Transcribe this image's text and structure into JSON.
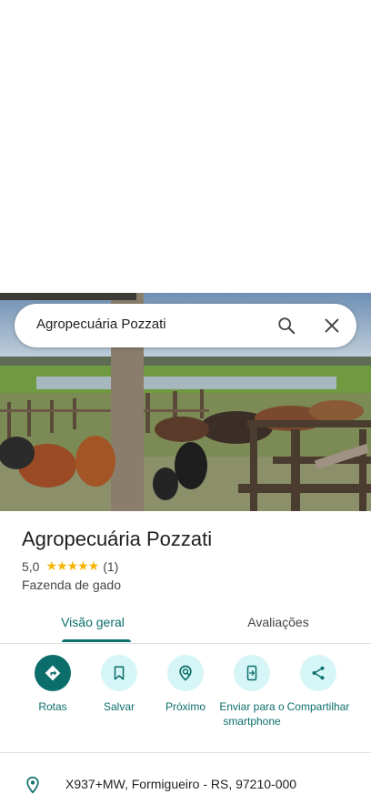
{
  "search": {
    "query": "Agropecuária Pozzati"
  },
  "place": {
    "title": "Agropecuária Pozzati",
    "rating": "5,0",
    "stars": "★★★★★",
    "review_count": "(1)",
    "category": "Fazenda de gado"
  },
  "tabs": [
    {
      "label": "Visão geral",
      "active": true
    },
    {
      "label": "Avaliações",
      "active": false
    }
  ],
  "actions": [
    {
      "label": "Rotas",
      "icon": "directions-icon"
    },
    {
      "label": "Salvar",
      "icon": "bookmark-icon"
    },
    {
      "label": "Próximo",
      "icon": "nearby-icon"
    },
    {
      "label": "Enviar para o smartphone",
      "icon": "send-to-phone-icon"
    },
    {
      "label": "Compartilhar",
      "icon": "share-icon"
    }
  ],
  "address": {
    "text": "X937+MW, Formigueiro - RS, 97210-000",
    "icon": "location-pin-icon"
  },
  "colors": {
    "accent": "#0b6e6b",
    "action_bg": "#d6f5f6",
    "star": "#f5b400"
  }
}
